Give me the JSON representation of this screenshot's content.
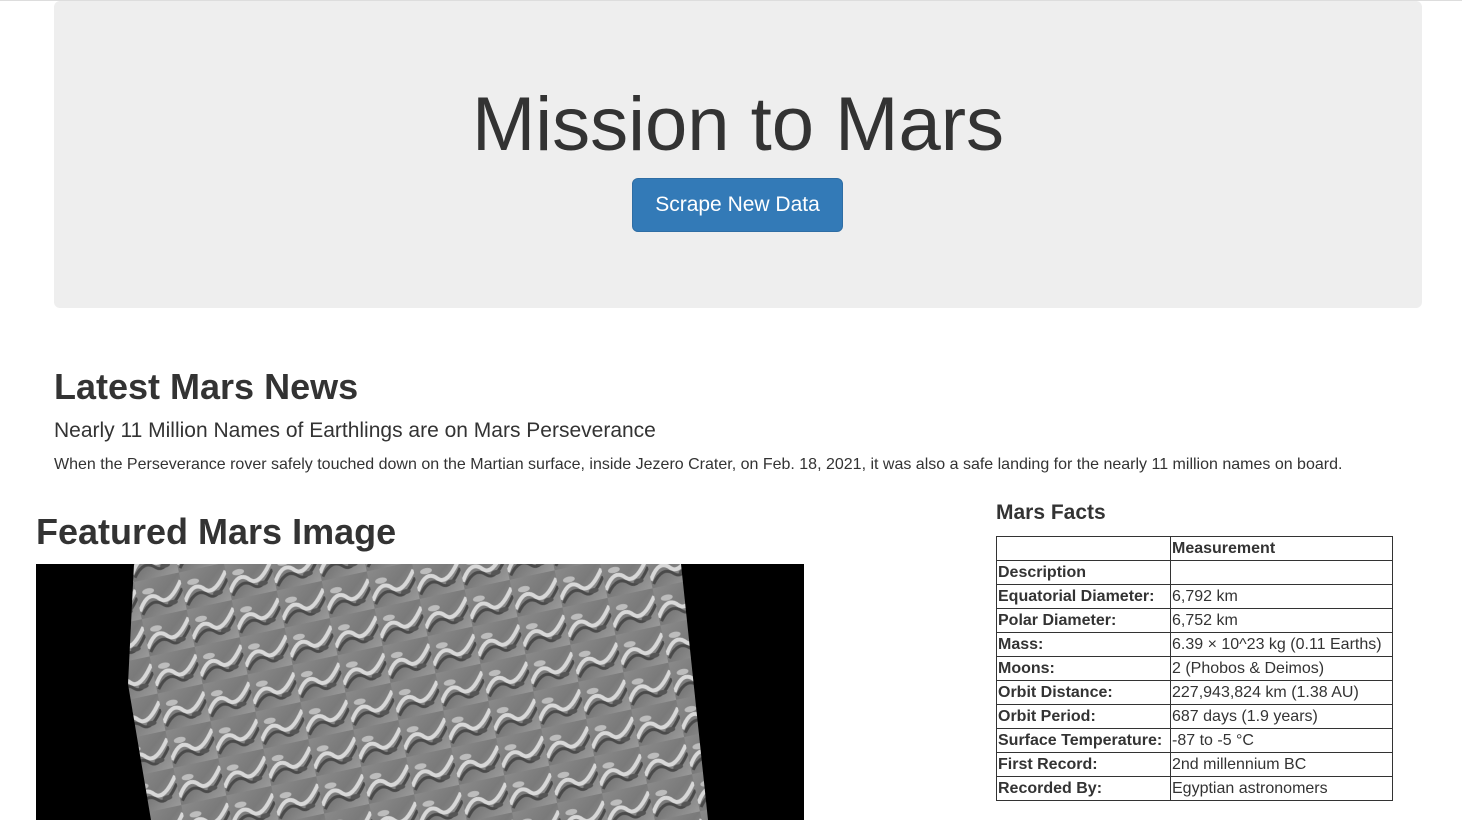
{
  "header": {
    "title": "Mission to Mars",
    "scrape_button_label": "Scrape New Data"
  },
  "news": {
    "heading": "Latest Mars News",
    "title": "Nearly 11 Million Names of Earthlings are on Mars Perseverance",
    "body": "When the Perseverance rover safely touched down on the Martian surface, inside Jezero Crater, on Feb. 18, 2021, it was also a safe landing for the nearly 11 million names on board."
  },
  "featured": {
    "heading": "Featured Mars Image",
    "image_icon": "mars-dunes-image"
  },
  "facts": {
    "heading": "Mars Facts",
    "column_header": "Measurement",
    "index_label": "Description",
    "rows": [
      {
        "key": "Equatorial Diameter:",
        "value": "6,792 km"
      },
      {
        "key": "Polar Diameter:",
        "value": "6,752 km"
      },
      {
        "key": "Mass:",
        "value": "6.39 × 10^23 kg (0.11 Earths)"
      },
      {
        "key": "Moons:",
        "value": "2 (Phobos & Deimos)"
      },
      {
        "key": "Orbit Distance:",
        "value": "227,943,824 km (1.38 AU)"
      },
      {
        "key": "Orbit Period:",
        "value": "687 days (1.9 years)"
      },
      {
        "key": "Surface Temperature:",
        "value": "-87 to -5 °C"
      },
      {
        "key": "First Record:",
        "value": "2nd millennium BC"
      },
      {
        "key": "Recorded By:",
        "value": "Egyptian astronomers"
      }
    ]
  },
  "colors": {
    "accent": "#337ab7",
    "jumbotron_bg": "#eeeeee",
    "text": "#333333"
  }
}
